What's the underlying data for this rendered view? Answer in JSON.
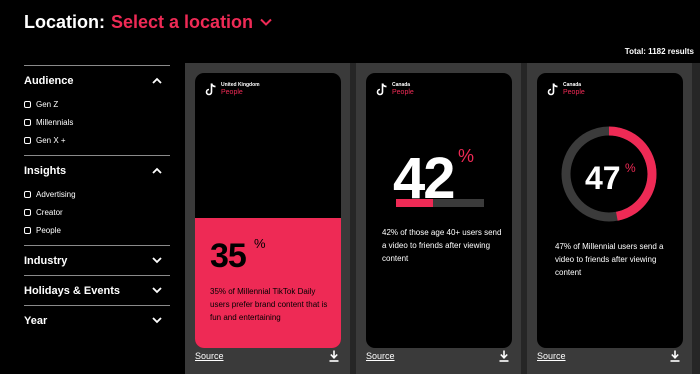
{
  "header": {
    "label": "Location:",
    "select_label": "Select a location"
  },
  "total": "Total: 1182 results",
  "sidebar": {
    "audience": {
      "title": "Audience",
      "options": [
        "Gen Z",
        "Millennials",
        "Gen X +"
      ]
    },
    "insights": {
      "title": "Insights",
      "options": [
        "Advertising",
        "Creator",
        "People"
      ]
    },
    "industry": {
      "title": "Industry"
    },
    "holidays": {
      "title": "Holidays & Events"
    },
    "year": {
      "title": "Year"
    }
  },
  "cards": [
    {
      "country": "United Kingdom",
      "category": "People",
      "stat": "35",
      "pct_symbol": "%",
      "value": 35,
      "text": "35% of Millennial TikTok Daily users prefer brand content that is fun and entertaining",
      "source": "Source"
    },
    {
      "country": "Canada",
      "category": "People",
      "stat": "42",
      "pct_symbol": "%",
      "value": 42,
      "text": "42% of those age 40+ users send a video to friends after viewing content",
      "source": "Source"
    },
    {
      "country": "Canada",
      "category": "People",
      "stat": "47",
      "pct_symbol": "%",
      "value": 47,
      "text": "47% of Millennial users send a video to friends after viewing content",
      "source": "Source"
    }
  ],
  "colors": {
    "accent": "#ee2a55",
    "background": "#000000",
    "card_panel": "#3a3a3a",
    "panel": "#262626"
  }
}
